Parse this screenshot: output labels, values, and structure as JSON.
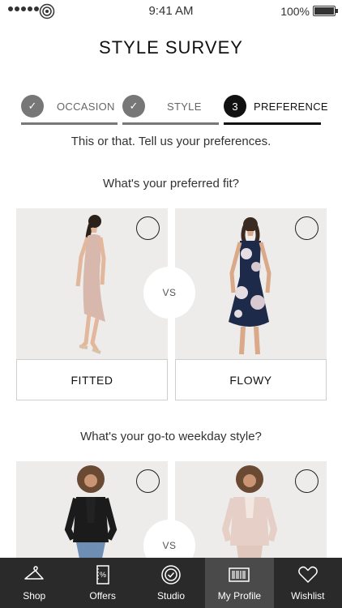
{
  "status": {
    "time": "9:41 AM",
    "battery": "100%"
  },
  "title": "STYLE SURVEY",
  "steps": [
    {
      "label": "OCCASION",
      "marker": "✓",
      "state": "done"
    },
    {
      "label": "STYLE",
      "marker": "✓",
      "state": "done"
    },
    {
      "label": "PREFERENCE",
      "marker": "3",
      "state": "active"
    }
  ],
  "intro": "This or that. Tell us your preferences.",
  "questions": [
    {
      "text": "What's your preferred fit?",
      "left_label": "FITTED",
      "right_label": "FLOWY",
      "vs": "VS"
    },
    {
      "text": "What's your go-to weekday style?",
      "vs": "VS"
    }
  ],
  "tabs": [
    {
      "label": "Shop",
      "icon": "hanger-icon"
    },
    {
      "label": "Offers",
      "icon": "coupon-icon"
    },
    {
      "label": "Studio",
      "icon": "check-circle-icon"
    },
    {
      "label": "My Profile",
      "icon": "barcode-icon"
    },
    {
      "label": "Wishlist",
      "icon": "heart-icon"
    }
  ],
  "colors": {
    "tab_bar": "#2a2a2a",
    "tab_active": "#4a4a4a",
    "step_done": "#777777",
    "step_active": "#111111"
  }
}
